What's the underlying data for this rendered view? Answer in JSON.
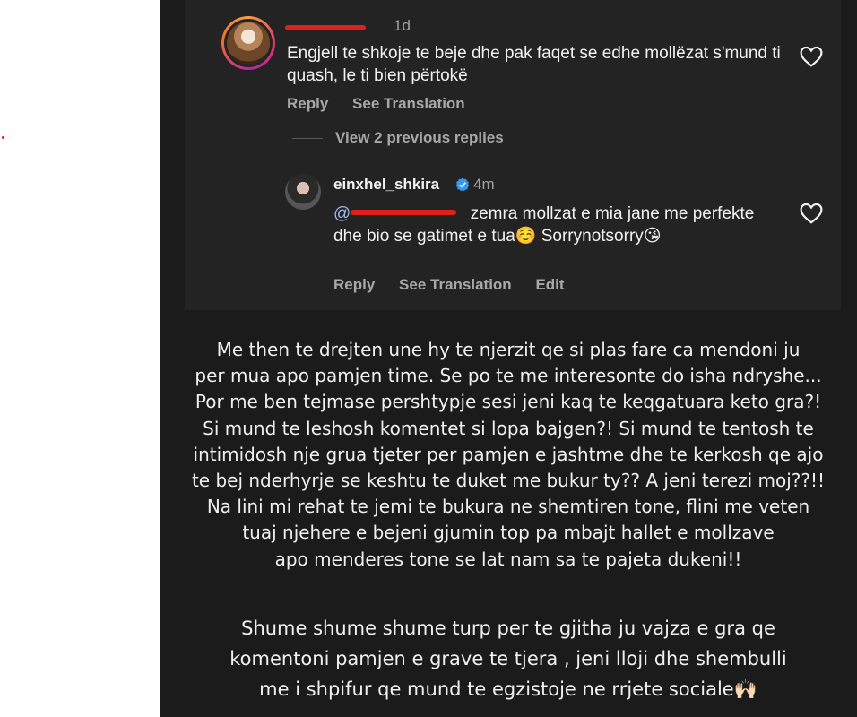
{
  "top_comment": {
    "username": "",
    "time": "1d",
    "text": "Engjell te shkoje te beje dhe pak faqet se edhe mollëzat s'mund ti quash, le ti bien përtokë",
    "reply_label": "Reply",
    "translation_label": "See Translation"
  },
  "view_replies_label": "View 2 previous replies",
  "reply_comment": {
    "username": "einxhel_shkira",
    "time": "4m",
    "mention": "@",
    "text": " zemra mollzat e mia jane me perfekte dhe bio se gatimet e tua☺️ Sorrynotsorry😘",
    "reply_label": "Reply",
    "translation_label": "See Translation",
    "edit_label": "Edit"
  },
  "story_paragraph_1": "Me then te drejten une hy te njerzit qe si plas fare ca mendoni ju\nper mua apo pamjen time. Se po te me interesonte do isha ndryshe...\nPor me ben tejmase pershtypje sesi jeni kaq te keqgatuara keto gra?!\nSi mund te leshosh komentet si lopa bajgen?! Si mund te tentosh te\nintimidosh nje grua tjeter per pamjen e jashtme dhe te kerkosh qe ajo\nte bej nderhyrje se keshtu te duket me bukur ty?? A jeni terezi moj??!!\nNa lini mi rehat te jemi te bukura ne shemtiren tone, flini me veten\ntuaj njehere e bejeni gjumin top pa mbajt hallet e mollzave\napo menderes tone se lat nam sa te pajeta dukeni!!",
  "story_paragraph_2": "Shume shume shume turp per te gjitha ju vajza e gra qe\nkomentoni pamjen e grave te tjera , jeni lloji dhe shembulli\nme i shpifur qe mund te egzistoje ne rrjete sociale🙌🏻",
  "colors": {
    "panel_bg": "#1b1b1b",
    "card_bg": "#232323",
    "redaction": "#e0201a",
    "verified": "#3897f0"
  }
}
